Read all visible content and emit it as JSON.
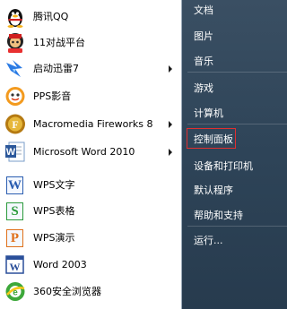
{
  "programs": [
    {
      "label": "腾讯QQ",
      "icon": "qq-penguin-icon",
      "has_submenu": false
    },
    {
      "label": "11对战平台",
      "icon": "11-platform-icon",
      "has_submenu": false
    },
    {
      "label": "启动迅雷7",
      "icon": "thunder-bird-icon",
      "has_submenu": true
    },
    {
      "label": "PPS影音",
      "icon": "pps-player-icon",
      "has_submenu": false
    },
    {
      "label": "Macromedia Fireworks 8",
      "icon": "fireworks-icon",
      "has_submenu": true
    },
    {
      "label": "Microsoft Word 2010",
      "icon": "word-2010-icon",
      "has_submenu": true
    },
    {
      "label": "WPS文字",
      "icon": "wps-writer-icon",
      "has_submenu": false
    },
    {
      "label": "WPS表格",
      "icon": "wps-spreadsheet-icon",
      "has_submenu": false
    },
    {
      "label": "WPS演示",
      "icon": "wps-presentation-icon",
      "has_submenu": false
    },
    {
      "label": "Word 2003",
      "icon": "word-2003-icon",
      "has_submenu": false
    },
    {
      "label": "360安全浏览器",
      "icon": "360-browser-icon",
      "has_submenu": false
    }
  ],
  "places": [
    {
      "label": "文档"
    },
    {
      "label": "图片"
    },
    {
      "label": "音乐"
    },
    {
      "label": "游戏"
    },
    {
      "label": "计算机"
    },
    {
      "label": "控制面板",
      "highlighted": true
    },
    {
      "label": "设备和打印机"
    },
    {
      "label": "默认程序"
    },
    {
      "label": "帮助和支持"
    },
    {
      "label": "运行..."
    }
  ],
  "colors": {
    "highlight_border": "#e03030",
    "right_pane": "#2e4458",
    "left_pane": "#ffffff"
  }
}
